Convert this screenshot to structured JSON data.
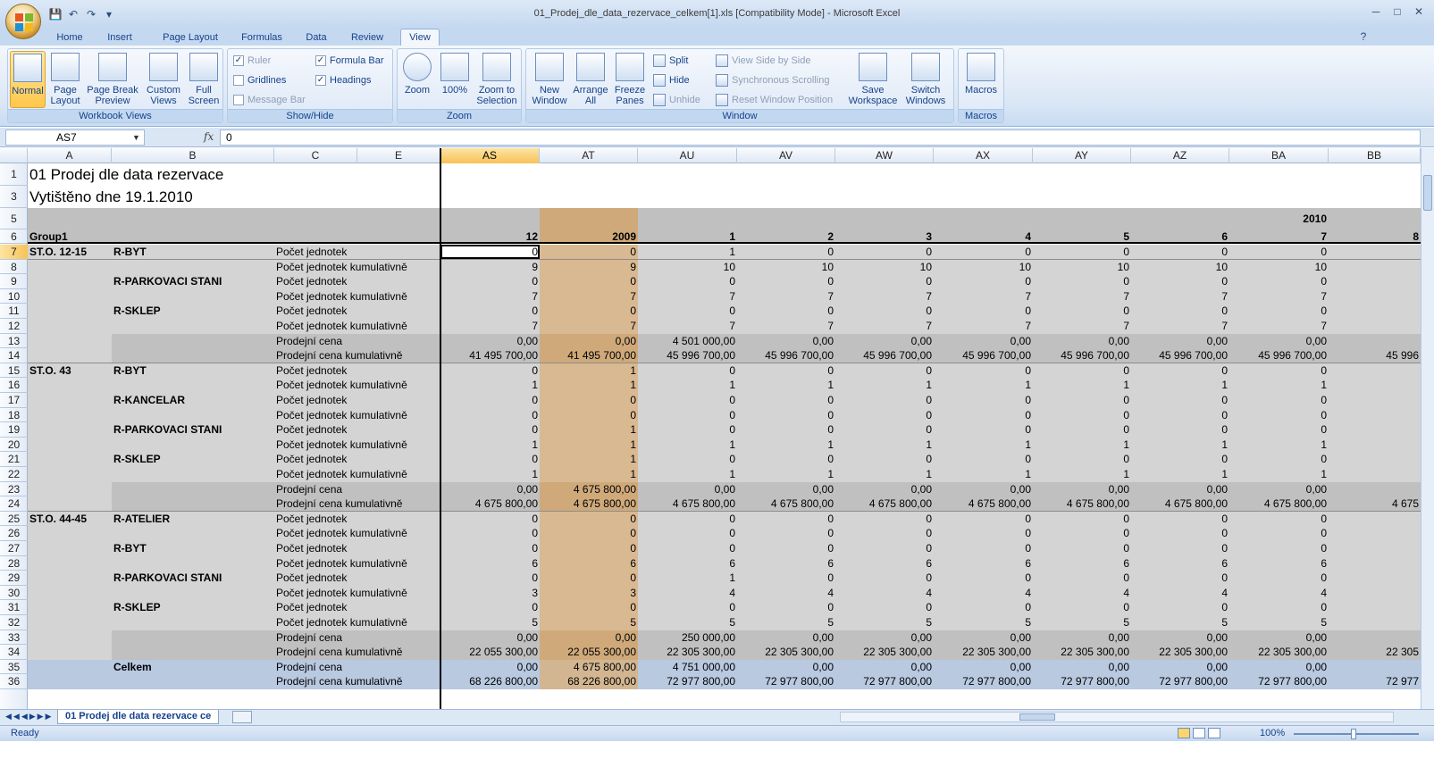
{
  "window": {
    "title": "01_Prodej_dle_data_rezervace_celkem[1].xls  [Compatibility Mode] - Microsoft Excel"
  },
  "tabs": [
    "Home",
    "Insert",
    "Page Layout",
    "Formulas",
    "Data",
    "Review",
    "View"
  ],
  "ribbon": {
    "workbook_views": {
      "label": "Workbook Views",
      "normal": "Normal",
      "page_layout": "Page Layout",
      "page_break": "Page Break Preview",
      "custom_views": "Custom Views",
      "full_screen": "Full Screen"
    },
    "show_hide": {
      "label": "Show/Hide",
      "ruler": "Ruler",
      "gridlines": "Gridlines",
      "message_bar": "Message Bar",
      "formula_bar": "Formula Bar",
      "headings": "Headings"
    },
    "zoom": {
      "label": "Zoom",
      "zoom": "Zoom",
      "hundred": "100%",
      "zoom_selection": "Zoom to Selection"
    },
    "window": {
      "label": "Window",
      "new_window": "New Window",
      "arrange_all": "Arrange All",
      "freeze_panes": "Freeze Panes",
      "split": "Split",
      "hide": "Hide",
      "unhide": "Unhide",
      "view_side": "View Side by Side",
      "sync_scroll": "Synchronous Scrolling",
      "reset_pos": "Reset Window Position",
      "save_ws": "Save Workspace",
      "switch_win": "Switch Windows"
    },
    "macros": {
      "label": "Macros",
      "macros": "Macros"
    }
  },
  "formula_bar": {
    "name_box": "AS7",
    "fx": "fx",
    "value": "0"
  },
  "columns": [
    "A",
    "B",
    "C",
    "E",
    "AS",
    "AT",
    "AU",
    "AV",
    "AW",
    "AX",
    "AY",
    "AZ",
    "BA",
    "BB"
  ],
  "sheet": {
    "title": "01 Prodej dle data rezervace",
    "printed": "Vytištěno dne 19.1.2010",
    "year2010": "2010",
    "group_label": "Group1",
    "headers": [
      "12",
      "2009",
      "1",
      "2",
      "3",
      "4",
      "5",
      "6",
      "7",
      "8"
    ],
    "rows": [
      {
        "n": "7",
        "a": "ST.O. 12-15",
        "b": "R-BYT",
        "c": "Počet jednotek",
        "v": [
          "0",
          "0",
          "1",
          "0",
          "0",
          "0",
          "0",
          "0",
          "0",
          ""
        ]
      },
      {
        "n": "8",
        "a": "",
        "b": "",
        "c": "Počet jednotek kumulativně",
        "v": [
          "9",
          "9",
          "10",
          "10",
          "10",
          "10",
          "10",
          "10",
          "10",
          ""
        ]
      },
      {
        "n": "9",
        "a": "",
        "b": "R-PARKOVACI STANI",
        "c": "Počet jednotek",
        "v": [
          "0",
          "0",
          "0",
          "0",
          "0",
          "0",
          "0",
          "0",
          "0",
          ""
        ]
      },
      {
        "n": "10",
        "a": "",
        "b": "",
        "c": "Počet jednotek kumulativně",
        "v": [
          "7",
          "7",
          "7",
          "7",
          "7",
          "7",
          "7",
          "7",
          "7",
          ""
        ]
      },
      {
        "n": "11",
        "a": "",
        "b": "R-SKLEP",
        "c": "Počet jednotek",
        "v": [
          "0",
          "0",
          "0",
          "0",
          "0",
          "0",
          "0",
          "0",
          "0",
          ""
        ]
      },
      {
        "n": "12",
        "a": "",
        "b": "",
        "c": "Počet jednotek kumulativně",
        "v": [
          "7",
          "7",
          "7",
          "7",
          "7",
          "7",
          "7",
          "7",
          "7",
          ""
        ]
      },
      {
        "n": "13",
        "a": "",
        "b": "",
        "c": "Prodejní cena",
        "v": [
          "0,00",
          "0,00",
          "4 501 000,00",
          "0,00",
          "0,00",
          "0,00",
          "0,00",
          "0,00",
          "0,00",
          ""
        ]
      },
      {
        "n": "14",
        "a": "",
        "b": "",
        "c": "Prodejní cena kumulativně",
        "v": [
          "41 495 700,00",
          "41 495 700,00",
          "45 996 700,00",
          "45 996 700,00",
          "45 996 700,00",
          "45 996 700,00",
          "45 996 700,00",
          "45 996 700,00",
          "45 996 700,00",
          "45 996"
        ]
      },
      {
        "n": "15",
        "a": "ST.O. 43",
        "b": "R-BYT",
        "c": "Počet jednotek",
        "v": [
          "0",
          "1",
          "0",
          "0",
          "0",
          "0",
          "0",
          "0",
          "0",
          ""
        ]
      },
      {
        "n": "16",
        "a": "",
        "b": "",
        "c": "Počet jednotek kumulativně",
        "v": [
          "1",
          "1",
          "1",
          "1",
          "1",
          "1",
          "1",
          "1",
          "1",
          ""
        ]
      },
      {
        "n": "17",
        "a": "",
        "b": "R-KANCELAR",
        "c": "Počet jednotek",
        "v": [
          "0",
          "0",
          "0",
          "0",
          "0",
          "0",
          "0",
          "0",
          "0",
          ""
        ]
      },
      {
        "n": "18",
        "a": "",
        "b": "",
        "c": "Počet jednotek kumulativně",
        "v": [
          "0",
          "0",
          "0",
          "0",
          "0",
          "0",
          "0",
          "0",
          "0",
          ""
        ]
      },
      {
        "n": "19",
        "a": "",
        "b": "R-PARKOVACI STANI",
        "c": "Počet jednotek",
        "v": [
          "0",
          "1",
          "0",
          "0",
          "0",
          "0",
          "0",
          "0",
          "0",
          ""
        ]
      },
      {
        "n": "20",
        "a": "",
        "b": "",
        "c": "Počet jednotek kumulativně",
        "v": [
          "1",
          "1",
          "1",
          "1",
          "1",
          "1",
          "1",
          "1",
          "1",
          ""
        ]
      },
      {
        "n": "21",
        "a": "",
        "b": "R-SKLEP",
        "c": "Počet jednotek",
        "v": [
          "0",
          "1",
          "0",
          "0",
          "0",
          "0",
          "0",
          "0",
          "0",
          ""
        ]
      },
      {
        "n": "22",
        "a": "",
        "b": "",
        "c": "Počet jednotek kumulativně",
        "v": [
          "1",
          "1",
          "1",
          "1",
          "1",
          "1",
          "1",
          "1",
          "1",
          ""
        ]
      },
      {
        "n": "23",
        "a": "",
        "b": "",
        "c": "Prodejní cena",
        "v": [
          "0,00",
          "4 675 800,00",
          "0,00",
          "0,00",
          "0,00",
          "0,00",
          "0,00",
          "0,00",
          "0,00",
          ""
        ]
      },
      {
        "n": "24",
        "a": "",
        "b": "",
        "c": "Prodejní cena kumulativně",
        "v": [
          "4 675 800,00",
          "4 675 800,00",
          "4 675 800,00",
          "4 675 800,00",
          "4 675 800,00",
          "4 675 800,00",
          "4 675 800,00",
          "4 675 800,00",
          "4 675 800,00",
          "4 675"
        ]
      },
      {
        "n": "25",
        "a": "ST.O. 44-45",
        "b": "R-ATELIER",
        "c": "Počet jednotek",
        "v": [
          "0",
          "0",
          "0",
          "0",
          "0",
          "0",
          "0",
          "0",
          "0",
          ""
        ]
      },
      {
        "n": "26",
        "a": "",
        "b": "",
        "c": "Počet jednotek kumulativně",
        "v": [
          "0",
          "0",
          "0",
          "0",
          "0",
          "0",
          "0",
          "0",
          "0",
          ""
        ]
      },
      {
        "n": "27",
        "a": "",
        "b": "R-BYT",
        "c": "Počet jednotek",
        "v": [
          "0",
          "0",
          "0",
          "0",
          "0",
          "0",
          "0",
          "0",
          "0",
          ""
        ]
      },
      {
        "n": "28",
        "a": "",
        "b": "",
        "c": "Počet jednotek kumulativně",
        "v": [
          "6",
          "6",
          "6",
          "6",
          "6",
          "6",
          "6",
          "6",
          "6",
          ""
        ]
      },
      {
        "n": "29",
        "a": "",
        "b": "R-PARKOVACI STANI",
        "c": "Počet jednotek",
        "v": [
          "0",
          "0",
          "1",
          "0",
          "0",
          "0",
          "0",
          "0",
          "0",
          ""
        ]
      },
      {
        "n": "30",
        "a": "",
        "b": "",
        "c": "Počet jednotek kumulativně",
        "v": [
          "3",
          "3",
          "4",
          "4",
          "4",
          "4",
          "4",
          "4",
          "4",
          ""
        ]
      },
      {
        "n": "31",
        "a": "",
        "b": "R-SKLEP",
        "c": "Počet jednotek",
        "v": [
          "0",
          "0",
          "0",
          "0",
          "0",
          "0",
          "0",
          "0",
          "0",
          ""
        ]
      },
      {
        "n": "32",
        "a": "",
        "b": "",
        "c": "Počet jednotek kumulativně",
        "v": [
          "5",
          "5",
          "5",
          "5",
          "5",
          "5",
          "5",
          "5",
          "5",
          ""
        ]
      },
      {
        "n": "33",
        "a": "",
        "b": "",
        "c": "Prodejní cena",
        "v": [
          "0,00",
          "0,00",
          "250 000,00",
          "0,00",
          "0,00",
          "0,00",
          "0,00",
          "0,00",
          "0,00",
          ""
        ]
      },
      {
        "n": "34",
        "a": "",
        "b": "",
        "c": "Prodejní cena kumulativně",
        "v": [
          "22 055 300,00",
          "22 055 300,00",
          "22 305 300,00",
          "22 305 300,00",
          "22 305 300,00",
          "22 305 300,00",
          "22 305 300,00",
          "22 305 300,00",
          "22 305 300,00",
          "22 305"
        ]
      },
      {
        "n": "35",
        "a": "",
        "b": "Celkem",
        "c": "Prodejní cena",
        "v": [
          "0,00",
          "4 675 800,00",
          "4 751 000,00",
          "0,00",
          "0,00",
          "0,00",
          "0,00",
          "0,00",
          "0,00",
          ""
        ]
      },
      {
        "n": "36",
        "a": "",
        "b": "",
        "c": "Prodejní cena kumulativně",
        "v": [
          "68 226 800,00",
          "68 226 800,00",
          "72 977 800,00",
          "72 977 800,00",
          "72 977 800,00",
          "72 977 800,00",
          "72 977 800,00",
          "72 977 800,00",
          "72 977 800,00",
          "72 977"
        ]
      }
    ]
  },
  "sheet_tab": "01 Prodej dle data rezervace ce",
  "status": {
    "ready": "Ready",
    "zoom": "100%"
  }
}
